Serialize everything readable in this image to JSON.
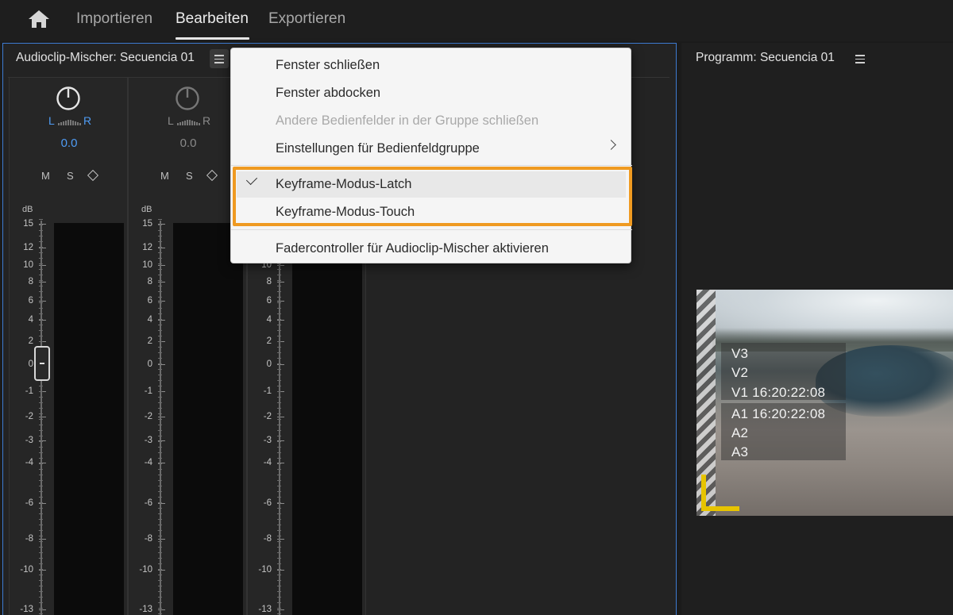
{
  "nav": {
    "home_icon": "home-icon",
    "tabs": [
      "Importieren",
      "Bearbeiten",
      "Exportieren"
    ],
    "active_tab": "Bearbeiten"
  },
  "audio_mixer": {
    "title": "Audioclip-Mischer: Secuencia 01",
    "channels": [
      {
        "left": "L",
        "right": "R",
        "volume": "0.0",
        "active": true
      },
      {
        "left": "L",
        "right": "R",
        "volume": "0.0",
        "active": false
      }
    ],
    "buttons": {
      "mute": "M",
      "solo": "S"
    },
    "db_label": "dB",
    "scale": [
      "15",
      "12",
      "10",
      "8",
      "6",
      "4",
      "2",
      "0",
      "-1",
      "-2",
      "-3",
      "-4",
      "-6",
      "-8",
      "-10",
      "-13"
    ]
  },
  "program": {
    "title": "Programm: Secuencia 01",
    "overlay": {
      "video_tracks": [
        "V3",
        "V2",
        "V1 16:20:22:08"
      ],
      "audio_tracks": [
        "A1 16:20:22:08",
        "A2",
        "A3"
      ]
    }
  },
  "context_menu": {
    "items": [
      {
        "label": "Fenster schließen",
        "disabled": false
      },
      {
        "label": "Fenster abdocken",
        "disabled": false
      },
      {
        "label": "Andere Bedienfelder in der Gruppe schließen",
        "disabled": true
      },
      {
        "label": "Einstellungen für Bedienfeldgruppe",
        "disabled": false,
        "submenu": true
      },
      {
        "label": "Keyframe-Modus-Latch",
        "disabled": false,
        "checked": true
      },
      {
        "label": "Keyframe-Modus-Touch",
        "disabled": false
      },
      {
        "label": "Fadercontroller für Audioclip-Mischer aktivieren",
        "disabled": false
      }
    ]
  },
  "colors": {
    "accent_blue": "#4f9cf5",
    "highlight_orange": "#ef9a21",
    "panel_border": "#3d7bd1",
    "marker_yellow": "#e7c400"
  }
}
